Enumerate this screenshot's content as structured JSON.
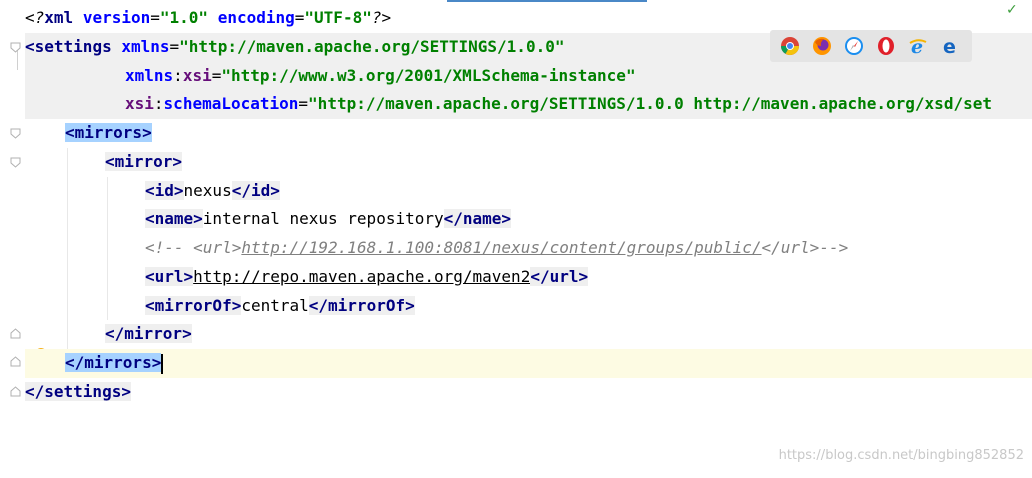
{
  "editor": {
    "file_status": "✓",
    "lines": {
      "l1": {
        "open": "<?",
        "name": "xml",
        "a1": "version",
        "eq1": "=",
        "v1": "\"1.0\"",
        "a2": "encoding",
        "eq2": "=",
        "v2": "\"UTF-8\"",
        "close": "?>"
      },
      "l2": {
        "lt": "<",
        "name": "settings",
        "attr": "xmlns",
        "eq": "=",
        "val": "\"http://maven.apache.org/SETTINGS/1.0.0\""
      },
      "l3": {
        "ns": "xmlns",
        "colon": ":",
        "attr": "xsi",
        "eq": "=",
        "val": "\"http://www.w3.org/2001/XMLSchema-instance\""
      },
      "l4": {
        "ns": "xsi",
        "colon": ":",
        "attr": "schemaLocation",
        "eq": "=",
        "val": "\"http://maven.apache.org/SETTINGS/1.0.0 http://maven.apache.org/xsd/set"
      },
      "l5": {
        "tag": "<mirrors>"
      },
      "l6": {
        "tag": "<mirror>"
      },
      "l7": {
        "open": "<id>",
        "text": "nexus",
        "close": "</id>"
      },
      "l8": {
        "open": "<name>",
        "text": "internal nexus repository",
        "close": "</name>"
      },
      "l9": {
        "start": "<!-- ",
        "open": "<url>",
        "link": "http://192.168.1.100:8081/nexus/content/groups/public/",
        "close": "</url>",
        "end": "-->"
      },
      "l10": {
        "open": "<url>",
        "link": "http://repo.maven.apache.org/maven2",
        "close": "</url>"
      },
      "l11": {
        "open": "<mirrorOf>",
        "text": "central",
        "close": "</mirrorOf>"
      },
      "l12": {
        "tag": "</mirror>"
      },
      "l13": {
        "tag": "</mirrors>"
      },
      "l14": {
        "tag": "</settings>"
      }
    }
  },
  "browsers": [
    "chrome-icon",
    "firefox-icon",
    "safari-icon",
    "opera-icon",
    "internet-explorer-icon",
    "edge-icon"
  ],
  "watermark": "https://blog.csdn.net/bingbing852852",
  "colors": {
    "tag": "#000080",
    "attribute": "#0000ff",
    "value": "#008000",
    "comment": "#808080",
    "selection": "#a6d2ff",
    "caret_line": "#fdfbe3"
  }
}
